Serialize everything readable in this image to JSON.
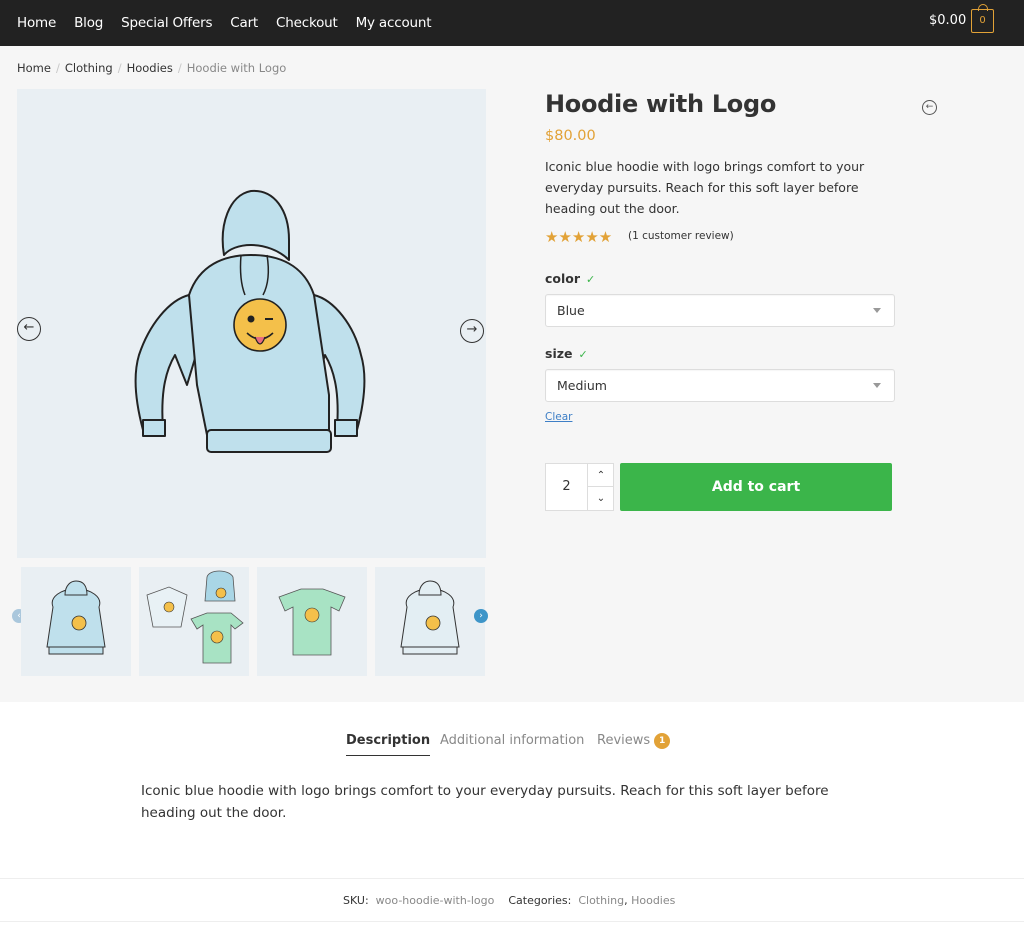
{
  "nav": {
    "items": [
      "Home",
      "Blog",
      "Special Offers",
      "Cart",
      "Checkout",
      "My account"
    ],
    "cart_total": "$0.00",
    "cart_count": "0"
  },
  "breadcrumb": {
    "items": [
      "Home",
      "Clothing",
      "Hoodies"
    ],
    "current": "Hoodie with Logo"
  },
  "product": {
    "title": "Hoodie with Logo",
    "price": "$80.00",
    "short_description": "Iconic blue hoodie with logo brings comfort to your everyday pursuits. Reach for this soft layer before heading out the door.",
    "stars": "★★★★★",
    "rating": 5,
    "review_link": "(1 customer review)",
    "variations": [
      {
        "label": "color",
        "value": "Blue"
      },
      {
        "label": "size",
        "value": "Medium"
      }
    ],
    "clear_label": "Clear",
    "quantity": "2",
    "add_to_cart": "Add to cart"
  },
  "tabs": {
    "items": [
      "Description",
      "Additional information",
      "Reviews"
    ],
    "reviews_count": "1",
    "active": "Description",
    "description_text": "Iconic blue hoodie with logo brings comfort to your everyday pursuits. Reach for this soft layer before heading out the door."
  },
  "meta": {
    "sku_label": "SKU:",
    "sku": "woo-hoodie-with-logo",
    "categories_label": "Categories:",
    "categories": [
      "Clothing",
      "Hoodies"
    ]
  },
  "colors": {
    "accent": "#e2a237",
    "button": "#3bb54a",
    "header": "#222222"
  }
}
